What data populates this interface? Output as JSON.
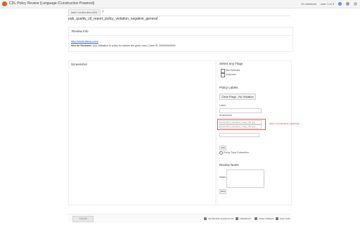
{
  "window": {
    "title": "CDL Policy Review (Language /Construction Powered)",
    "user_count": "12 members",
    "user_label": "user 1 of 3"
  },
  "tab": {
    "label": "task-1-review-item-0001",
    "close": "×"
  },
  "heading": "pub_quality_ctl_report_policy_violation_negative_general",
  "review_info": {
    "title": "Review Info",
    "link": "http://www.alexa.com/",
    "desc_bold": "Hint for Reviewer:",
    "desc": "Add Validation to policy for answer the given rows | Case ID: 000000000000"
  },
  "screenshot_label": "Screenshot",
  "right": {
    "select_flags": "Select any Flags",
    "flag1": "Not Relevant",
    "flag2": "Unknown",
    "policy_labels": "Policy Labels",
    "clear_button": "Clear Flags - No Violation",
    "label": "Label",
    "screenshot": "Screenshot",
    "shot_value1": "screenshot_uploaded_image_file.png",
    "shot_value2": "screenshot_uploaded_image_file.png",
    "red_link": "Add a screenshot (optional)",
    "add_btn": "Add",
    "radio_text": "Policy Topic Evaluation",
    "review_notes": "Review Notes",
    "notes_label": "Notes",
    "save_btn": "Save"
  },
  "bottom": {
    "submit": "Submit",
    "item1": "KEYBOARD SHORTCUTS",
    "item2": "FEEDBACK",
    "item3": "TAKE A BREAK",
    "item4": "SKIP TASK"
  }
}
